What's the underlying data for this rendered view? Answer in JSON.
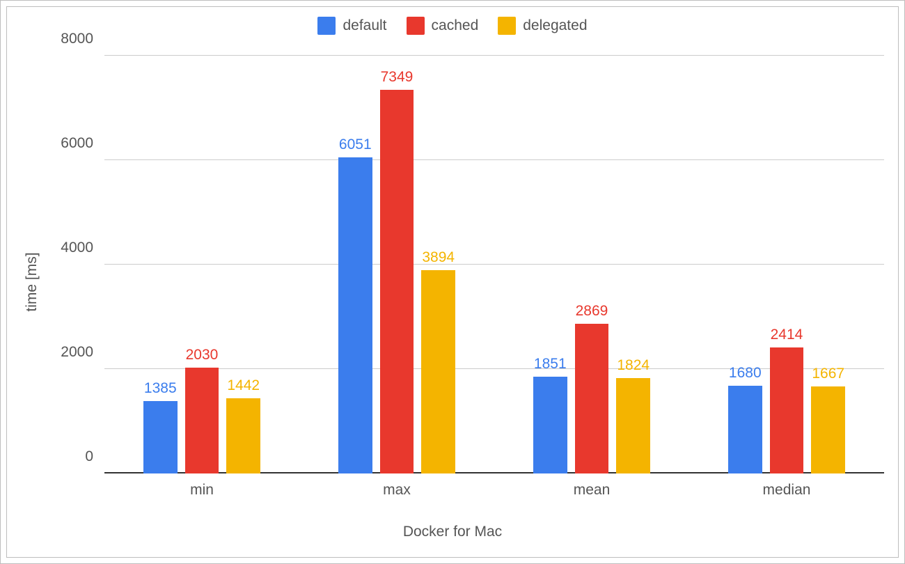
{
  "chart_data": {
    "type": "bar",
    "xlabel": "Docker for Mac",
    "ylabel": "time [ms]",
    "ylim": [
      0,
      8000
    ],
    "yticks": [
      0,
      2000,
      4000,
      6000,
      8000
    ],
    "categories": [
      "min",
      "max",
      "mean",
      "median"
    ],
    "series": [
      {
        "name": "default",
        "color": "#3b7ded",
        "values": [
          1385,
          6051,
          1851,
          1680
        ]
      },
      {
        "name": "cached",
        "color": "#e8382d",
        "values": [
          2030,
          7349,
          2869,
          2414
        ]
      },
      {
        "name": "delegated",
        "color": "#f4b400",
        "values": [
          1442,
          3894,
          1824,
          1667
        ]
      }
    ],
    "legend_position": "top"
  }
}
